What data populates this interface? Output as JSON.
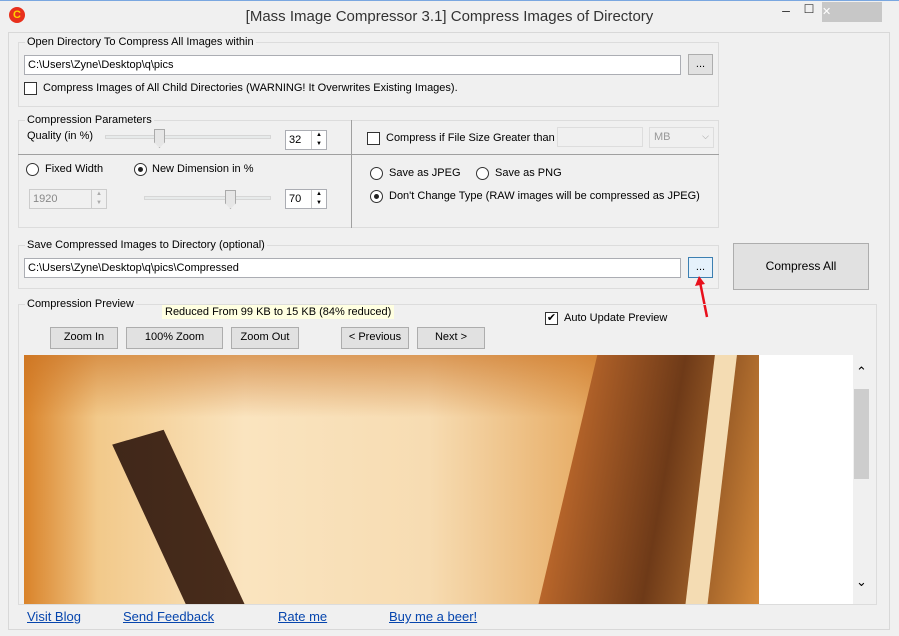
{
  "window": {
    "title": "[Mass Image Compressor 3.1] Compress Images of Directory",
    "minimize": "–",
    "maximize": "☐",
    "close": "✕",
    "icon": "C"
  },
  "source": {
    "label": "Open Directory To Compress All Images within",
    "path": "C:\\Users\\Zyne\\Desktop\\q\\pics",
    "browse": "...",
    "child_dirs_label": "Compress Images of All Child Directories (WARNING! It Overwrites Existing Images).",
    "child_dirs_checked": false
  },
  "params": {
    "label": "Compression Parameters",
    "quality_label": "Quality (in %)",
    "quality": "32",
    "quality_slider_percent": 32,
    "fixed_width_label": "Fixed Width",
    "fixed_width": "1920",
    "new_dim_label": "New Dimension in %",
    "new_dim": "70",
    "dim_slider_percent": 70,
    "size_check_label": "Compress if File Size Greater than",
    "size_value": "",
    "size_unit": "MB",
    "save_jpeg": "Save as JPEG",
    "save_png": "Save as PNG",
    "no_change": "Don't Change Type (RAW images will be compressed as JPEG)"
  },
  "dest": {
    "label": "Save Compressed Images to Directory (optional)",
    "path": "C:\\Users\\Zyne\\Desktop\\q\\pics\\Compressed",
    "browse": "..."
  },
  "compress_all": "Compress All",
  "preview": {
    "label": "Compression Preview",
    "info": "Reduced From 99 KB to 15 KB (84% reduced)",
    "auto_update": "Auto Update Preview",
    "auto_checked": true,
    "buttons": [
      "Zoom In",
      "100% Zoom",
      "Zoom Out",
      "< Previous",
      "Next >"
    ]
  },
  "links": [
    "Visit Blog",
    "Send Feedback",
    "Rate me",
    "Buy me a beer!"
  ],
  "colors": {
    "accent_arrow": "#e8101c",
    "link": "#0645ad"
  }
}
